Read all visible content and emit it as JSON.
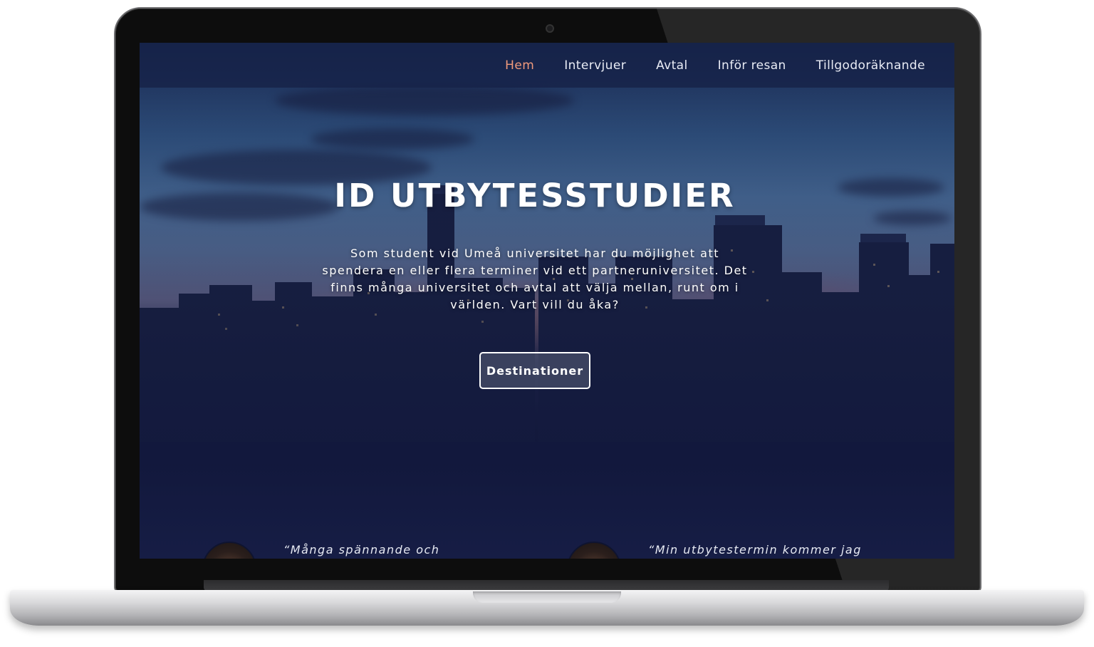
{
  "nav": {
    "items": [
      {
        "label": "Hem",
        "active": true
      },
      {
        "label": "Intervjuer",
        "active": false
      },
      {
        "label": "Avtal",
        "active": false
      },
      {
        "label": "Inför resan",
        "active": false
      },
      {
        "label": "Tillgodoräknande",
        "active": false
      }
    ]
  },
  "hero": {
    "title": "ID UTBYTESSTUDIER",
    "text": "Som student vid Umeå universitet har du möjlighet att spendera en eller flera terminer vid ett partneruniversitet. Det finns många universitet och avtal att välja mellan, runt om i världen. Vart vill du åka?",
    "button_label": "Destinationer"
  },
  "quotes": [
    {
      "text": "“Många spännande och"
    },
    {
      "text": "“Min utbytestermin kommer jag"
    }
  ],
  "colors": {
    "nav_active": "#f09a7c",
    "nav_text": "#e9ecf5",
    "nav_bg": "#162248",
    "page_bg": "#161d45"
  }
}
